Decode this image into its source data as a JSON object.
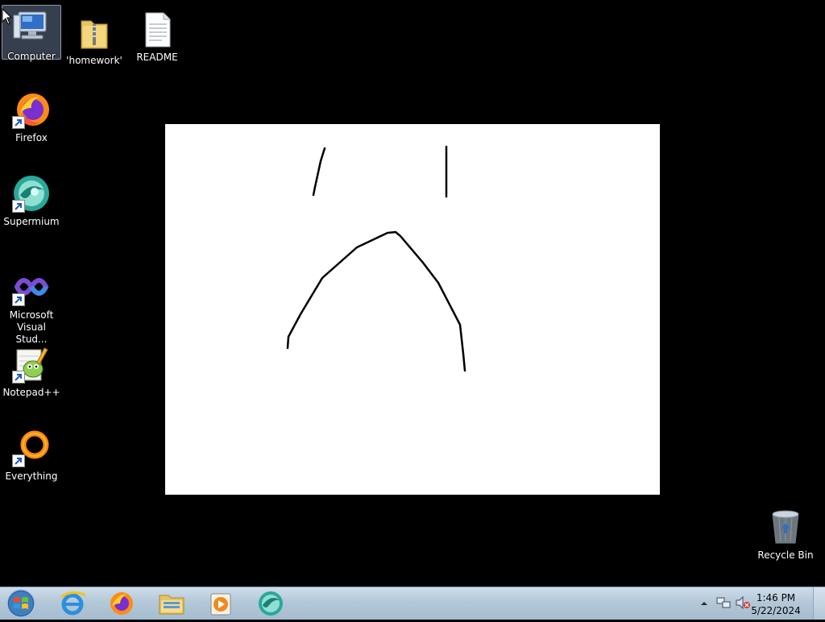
{
  "desktop": {
    "icons": [
      {
        "label": "Computer"
      },
      {
        "label": "'homework'"
      },
      {
        "label": "README"
      },
      {
        "label": "Firefox"
      },
      {
        "label": "Supermium"
      },
      {
        "label": "Microsoft Visual Stud..."
      },
      {
        "label": "Notepad++"
      },
      {
        "label": "Everything"
      },
      {
        "label": "Recycle Bin"
      }
    ]
  },
  "taskbar": {
    "pinned": [
      "start-orb",
      "internet-explorer-icon",
      "firefox-icon",
      "file-explorer-icon",
      "media-player-icon",
      "supermium-icon"
    ],
    "clock": {
      "time": "1:46 PM",
      "date": "5/22/2024"
    }
  },
  "colors": {
    "desktop_bg": "#000000",
    "canvas_bg": "#ffffff",
    "stroke": "#000000"
  }
}
